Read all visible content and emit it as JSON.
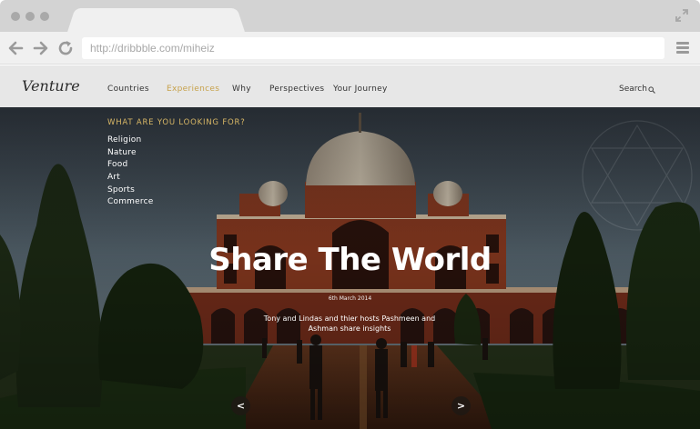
{
  "browser": {
    "url": "http://dribbble.com/miheiz"
  },
  "site": {
    "brand": "Venture",
    "nav": [
      {
        "label": "Countries",
        "active": false
      },
      {
        "label": "Experiences",
        "active": true
      },
      {
        "label": "Why",
        "active": false
      },
      {
        "label": "Perspectives",
        "active": false
      },
      {
        "label": "Your Journey",
        "active": false
      }
    ],
    "search_label": "Search",
    "accent_color": "#c7a24c"
  },
  "hero": {
    "looking_title": "WHAT ARE YOU LOOKING FOR?",
    "categories": [
      "Religion",
      "Nature",
      "Food",
      "Art",
      "Sports",
      "Commerce"
    ],
    "headline": "Share The World",
    "date": "6th March 2014",
    "subtitle": "Tony and Lindas and thier hosts Pashmeen and Ashman share insights",
    "prev_label": "<",
    "next_label": ">"
  }
}
